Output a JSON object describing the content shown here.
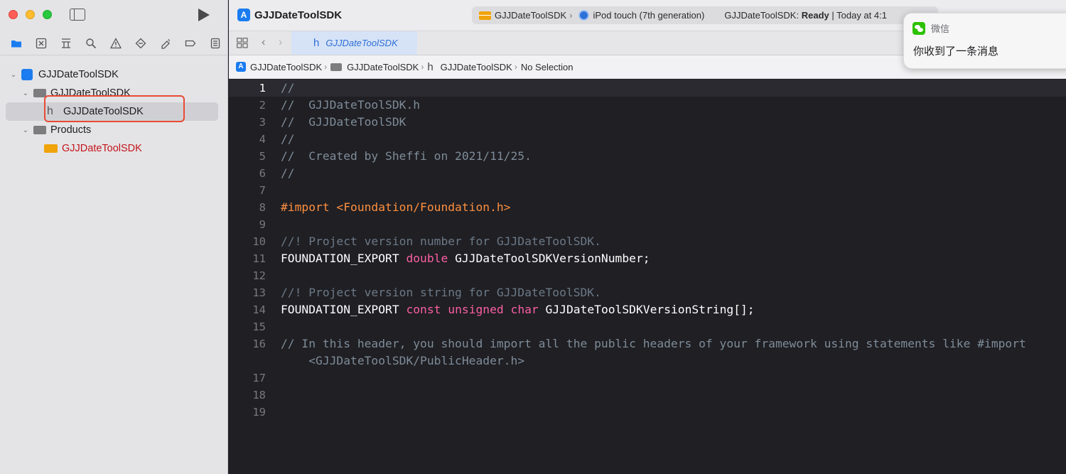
{
  "window": {
    "title": "GJJDateToolSDK"
  },
  "scheme": {
    "target": "GJJDateToolSDK",
    "device": "iPod touch (7th generation)",
    "status_target": "GJJDateToolSDK:",
    "status_state": "Ready",
    "status_time": "| Today at 4:1"
  },
  "navigator_tabs": [
    {
      "name": "project-navigator-icon",
      "active": true
    },
    {
      "name": "source-control-icon"
    },
    {
      "name": "symbol-navigator-icon"
    },
    {
      "name": "find-navigator-icon"
    },
    {
      "name": "issue-navigator-icon"
    },
    {
      "name": "test-navigator-icon"
    },
    {
      "name": "debug-navigator-icon"
    },
    {
      "name": "breakpoint-navigator-icon"
    },
    {
      "name": "report-navigator-icon"
    }
  ],
  "tree": {
    "project": "GJJDateToolSDK",
    "group": "GJJDateToolSDK",
    "header_file": "GJJDateToolSDK",
    "products_group": "Products",
    "product": "GJJDateToolSDK"
  },
  "editor_tab": {
    "label": "GJJDateToolSDK"
  },
  "jumpbar": {
    "project": "GJJDateToolSDK",
    "group": "GJJDateToolSDK",
    "file": "GJJDateToolSDK",
    "selection": "No Selection"
  },
  "code": {
    "lines": [
      {
        "n": "1",
        "current": true,
        "parts": [
          {
            "c": "cmt",
            "t": "//"
          }
        ]
      },
      {
        "n": "2",
        "parts": [
          {
            "c": "cmt",
            "t": "//  GJJDateToolSDK.h"
          }
        ]
      },
      {
        "n": "3",
        "parts": [
          {
            "c": "cmt",
            "t": "//  GJJDateToolSDK"
          }
        ]
      },
      {
        "n": "4",
        "parts": [
          {
            "c": "cmt",
            "t": "//"
          }
        ]
      },
      {
        "n": "5",
        "parts": [
          {
            "c": "cmt",
            "t": "//  Created by Sheffi on 2021/11/25."
          }
        ]
      },
      {
        "n": "6",
        "parts": [
          {
            "c": "cmt",
            "t": "//"
          }
        ]
      },
      {
        "n": "7",
        "parts": []
      },
      {
        "n": "8",
        "parts": [
          {
            "c": "pp",
            "t": "#import <Foundation/Foundation.h>"
          }
        ]
      },
      {
        "n": "9",
        "parts": []
      },
      {
        "n": "10",
        "parts": [
          {
            "c": "cmt-doc",
            "t": "//! Project version number for GJJDateToolSDK."
          }
        ]
      },
      {
        "n": "11",
        "parts": [
          {
            "c": "plain",
            "t": "FOUNDATION_EXPORT "
          },
          {
            "c": "kw",
            "t": "double"
          },
          {
            "c": "plain",
            "t": " GJJDateToolSDKVersionNumber;"
          }
        ]
      },
      {
        "n": "12",
        "parts": []
      },
      {
        "n": "13",
        "parts": [
          {
            "c": "cmt-doc",
            "t": "//! Project version string for GJJDateToolSDK."
          }
        ]
      },
      {
        "n": "14",
        "parts": [
          {
            "c": "plain",
            "t": "FOUNDATION_EXPORT "
          },
          {
            "c": "kw",
            "t": "const"
          },
          {
            "c": "plain",
            "t": " "
          },
          {
            "c": "kw",
            "t": "unsigned"
          },
          {
            "c": "plain",
            "t": " "
          },
          {
            "c": "kw",
            "t": "char"
          },
          {
            "c": "plain",
            "t": " GJJDateToolSDKVersionString[];"
          }
        ]
      },
      {
        "n": "15",
        "parts": []
      },
      {
        "n": "16",
        "parts": [
          {
            "c": "cmt",
            "t": "// In this header, you should import all the public headers of your framework using statements like #import"
          }
        ]
      },
      {
        "n": "",
        "parts": [
          {
            "c": "cmt",
            "t": "    <GJJDateToolSDK/PublicHeader.h>"
          }
        ]
      },
      {
        "n": "17",
        "parts": []
      },
      {
        "n": "18",
        "parts": []
      },
      {
        "n": "19",
        "parts": []
      }
    ]
  },
  "notification": {
    "app": "微信",
    "message": "你收到了一条消息"
  },
  "colors": {
    "accent": "#1b7cf0",
    "annotation_box": "#e84a35",
    "product_red": "#c4151c"
  }
}
